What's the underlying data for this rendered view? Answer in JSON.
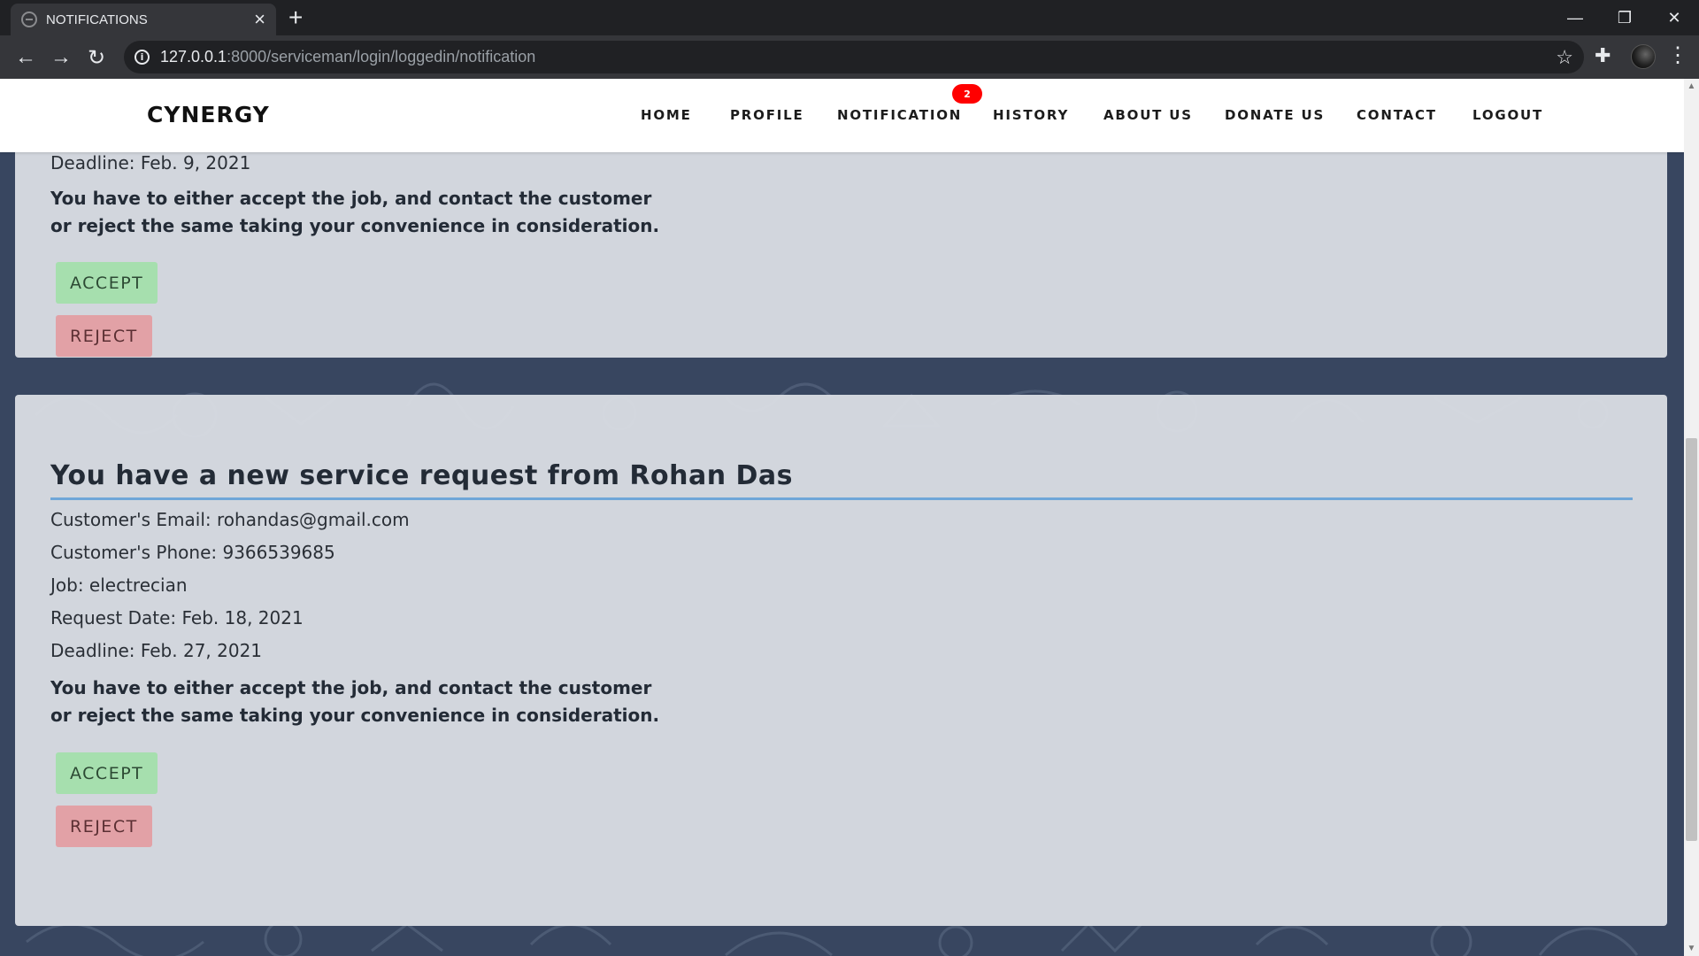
{
  "browser": {
    "tab_title": "NOTIFICATIONS",
    "url_host": "127.0.0.1",
    "url_path": ":8000/serviceman/login/loggedin/notification"
  },
  "navbar": {
    "brand": "CYNERGY",
    "links": [
      "HOME",
      "PROFILE",
      "NOTIFICATION",
      "HISTORY",
      "ABOUT US",
      "DONATE US",
      "CONTACT",
      "LOGOUT"
    ],
    "notification_count": "2"
  },
  "requests": [
    {
      "deadline": "Deadline: Feb. 9, 2021",
      "note_line1": "You have to either accept the job, and contact the customer",
      "note_line2": "or reject the same taking your convenience in consideration.",
      "accept_label": "ACCEPT",
      "reject_label": "REJECT"
    },
    {
      "heading": "You have a new service request from Rohan Das",
      "email": "Customer's Email: rohandas@gmail.com",
      "phone": "Customer's Phone: 9366539685",
      "job": "Job: electrecian",
      "request_date": "Request Date: Feb. 18, 2021",
      "deadline": "Deadline: Feb. 27, 2021",
      "note_line1": "You have to either accept the job, and contact the customer",
      "note_line2": "or reject the same taking your convenience in consideration.",
      "accept_label": "ACCEPT",
      "reject_label": "REJECT"
    }
  ],
  "colors": {
    "page_background": "#384660",
    "card_background": "#dee1e6",
    "accept_button": "#a6dfae",
    "reject_button": "#e2a1a6",
    "heading_rule": "#6fa6d8",
    "badge": "#ff0000"
  },
  "icons": {
    "back": "back-arrow-icon",
    "forward": "forward-arrow-icon",
    "reload": "reload-icon",
    "site_info": "info-icon",
    "bookmark": "star-icon",
    "extensions": "puzzle-icon",
    "menu": "kebab-menu-icon"
  }
}
